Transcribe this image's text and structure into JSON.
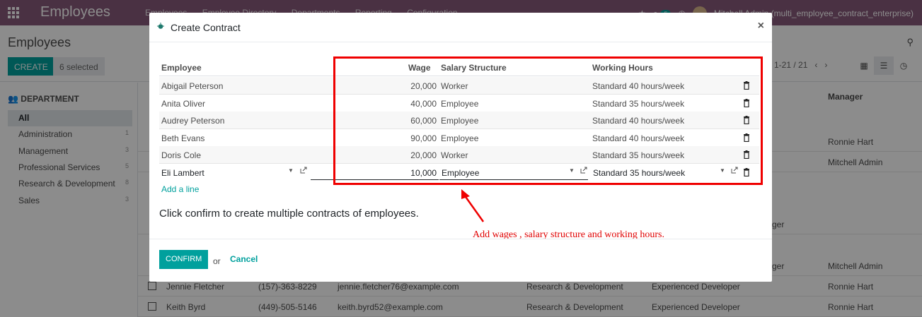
{
  "navbar": {
    "app_title": "Employees",
    "menu": [
      "Employees",
      "Employee Directory",
      "Departments",
      "Reporting",
      "Configuration"
    ],
    "message_count": "5",
    "user": "Mitchell Admin (multi_employee_contract_enterprise)"
  },
  "control_panel": {
    "breadcrumb": "Employees",
    "create_label": "CREATE",
    "selected_label": "6 selected",
    "pager": "1-21 / 21"
  },
  "sidebar": {
    "heading": "DEPARTMENT",
    "items": [
      {
        "label": "All",
        "count": ""
      },
      {
        "label": "Administration",
        "count": "1"
      },
      {
        "label": "Management",
        "count": "3"
      },
      {
        "label": "Professional Services",
        "count": "5"
      },
      {
        "label": "Research & Development",
        "count": "8"
      },
      {
        "label": "Sales",
        "count": "3"
      }
    ]
  },
  "background_list": {
    "manager_header": "Manager",
    "rows": [
      {
        "name": "",
        "phone": "",
        "email": "",
        "dept": "",
        "job": "",
        "manager": "Ronnie Hart"
      },
      {
        "name": "",
        "phone": "",
        "email": "",
        "dept": "",
        "job": "",
        "manager": "Mitchell Admin"
      },
      {
        "name": "",
        "phone": "",
        "email": "",
        "dept": "",
        "job": "ger",
        "manager": ""
      },
      {
        "name": "",
        "phone": "",
        "email": "",
        "dept": "",
        "job": "ger",
        "manager": "Mitchell Admin"
      },
      {
        "name": "Jennie Fletcher",
        "phone": "(157)-363-8229",
        "email": "jennie.fletcher76@example.com",
        "dept": "Research & Development",
        "job": "Experienced Developer",
        "manager": "Ronnie Hart"
      },
      {
        "name": "Keith Byrd",
        "phone": "(449)-505-5146",
        "email": "keith.byrd52@example.com",
        "dept": "Research & Development",
        "job": "Experienced Developer",
        "manager": "Ronnie Hart"
      }
    ]
  },
  "modal": {
    "title": "Create Contract",
    "columns": {
      "employee": "Employee",
      "wage": "Wage",
      "structure": "Salary Structure",
      "hours": "Working Hours"
    },
    "rows": [
      {
        "employee": "Abigail Peterson",
        "wage": "20,000",
        "structure": "Worker",
        "hours": "Standard 40 hours/week"
      },
      {
        "employee": "Anita Oliver",
        "wage": "40,000",
        "structure": "Employee",
        "hours": "Standard 35 hours/week"
      },
      {
        "employee": "Audrey Peterson",
        "wage": "60,000",
        "structure": "Employee",
        "hours": "Standard 40 hours/week"
      },
      {
        "employee": "Beth Evans",
        "wage": "90,000",
        "structure": "Employee",
        "hours": "Standard 40 hours/week"
      },
      {
        "employee": "Doris Cole",
        "wage": "20,000",
        "structure": "Worker",
        "hours": "Standard 35 hours/week"
      }
    ],
    "edit_row": {
      "employee": "Eli Lambert",
      "wage": "10,000",
      "structure": "Employee",
      "hours": "Standard 35 hours/week"
    },
    "add_line": "Add a line",
    "note": "Click confirm to create multiple contracts of employees.",
    "annotation": "Add wages , salary structure and working hours.",
    "confirm_label": "CONFIRM",
    "or_label": "or",
    "cancel_label": "Cancel"
  },
  "colors": {
    "navbar": "#875a7b",
    "accent": "#00a09d",
    "annotation_red": "#ef0000"
  }
}
